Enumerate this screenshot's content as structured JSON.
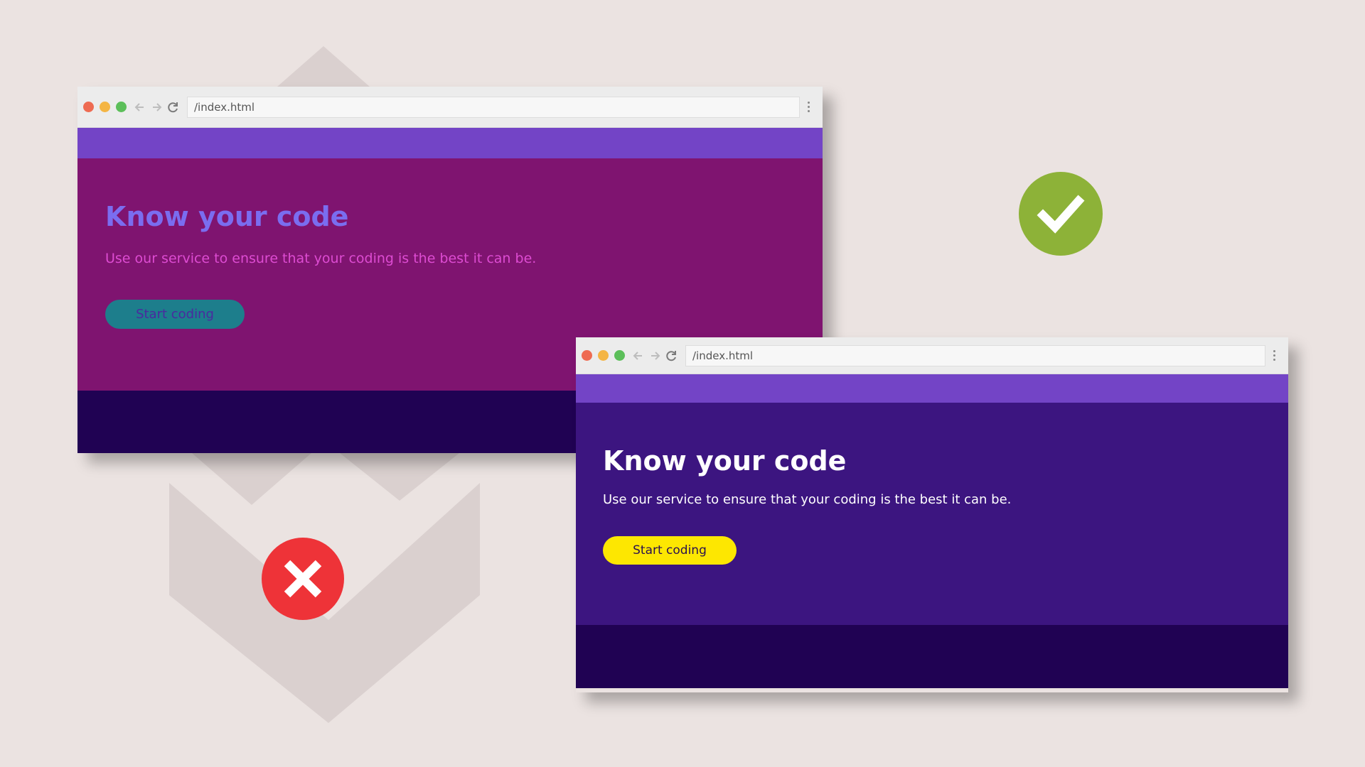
{
  "colors": {
    "background": "#ebe3e1",
    "shape": "#dad0cf",
    "nav_bar": "#7344c6",
    "footer": "#200253",
    "bad_hero_bg": "#7f1470",
    "bad_title": "#7a6df0",
    "bad_subtitle": "#dd4cd2",
    "bad_button_bg": "#1d7e8c",
    "bad_button_text": "#4a2a9f",
    "good_hero_bg": "#3c1580",
    "good_text": "#ffffff",
    "good_button_bg": "#fde701",
    "good_button_text": "#2a1050",
    "check_badge": "#8db238",
    "cross_badge": "#ee3338",
    "traffic_red": "#ee6b52",
    "traffic_yellow": "#f4b544",
    "traffic_green": "#5cbf5a"
  },
  "bad_browser": {
    "url": "/index.html",
    "hero_title": "Know your code",
    "hero_subtitle": "Use our service to ensure that your coding is the best it can be.",
    "cta_label": "Start coding",
    "verdict_icon": "cross-icon"
  },
  "good_browser": {
    "url": "/index.html",
    "hero_title": "Know your code",
    "hero_subtitle": "Use our service to ensure that your coding is the best it can be.",
    "cta_label": "Start coding",
    "verdict_icon": "check-icon"
  },
  "browser_chrome": {
    "icons": [
      "close-dot-icon",
      "minimize-dot-icon",
      "maximize-dot-icon",
      "back-arrow-icon",
      "forward-arrow-icon",
      "reload-icon",
      "menu-dots-icon"
    ]
  }
}
